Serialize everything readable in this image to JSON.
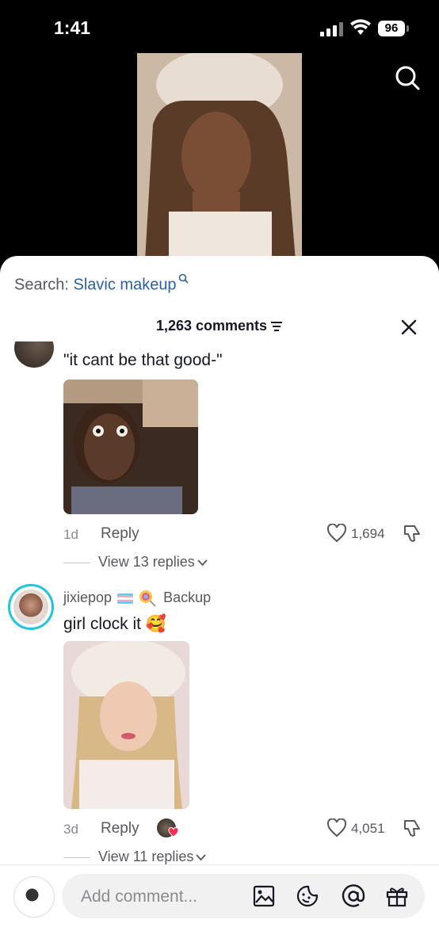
{
  "status_bar": {
    "time": "1:41",
    "battery": "96"
  },
  "sheet": {
    "search_label": "Search:",
    "search_query": "Slavic makeup",
    "comment_count": "1,263 comments"
  },
  "comments": [
    {
      "text": "\"it cant be that good-\"",
      "age": "1d",
      "reply_label": "Reply",
      "likes": "1,694",
      "view_replies": "View 13 replies"
    },
    {
      "username": "jixiepop",
      "user_suffix": "Backup",
      "text": "girl clock it 🥰",
      "age": "3d",
      "reply_label": "Reply",
      "likes": "4,051",
      "view_replies": "View 11 replies"
    }
  ],
  "composer": {
    "placeholder": "Add comment..."
  },
  "icons": [
    "search-icon",
    "filter-icon",
    "close-icon",
    "heart-icon",
    "dislike-icon",
    "chevron-down-icon",
    "image-icon",
    "sticker-icon",
    "mention-icon",
    "gift-icon"
  ]
}
